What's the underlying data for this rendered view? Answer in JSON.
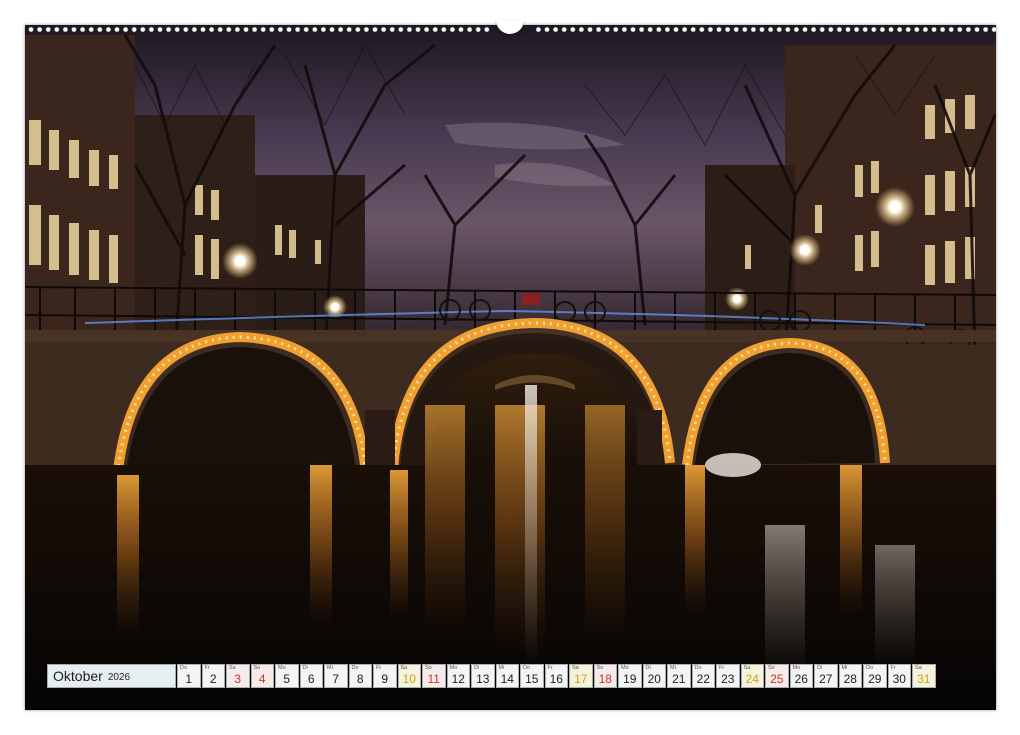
{
  "calendar": {
    "month": "Oktober",
    "year": "2026",
    "days": [
      {
        "abbr": "Do",
        "num": "1",
        "kind": "weekday"
      },
      {
        "abbr": "Fr",
        "num": "2",
        "kind": "weekday"
      },
      {
        "abbr": "Sa",
        "num": "3",
        "kind": "sun"
      },
      {
        "abbr": "So",
        "num": "4",
        "kind": "sun"
      },
      {
        "abbr": "Mo",
        "num": "5",
        "kind": "weekday"
      },
      {
        "abbr": "Di",
        "num": "6",
        "kind": "weekday"
      },
      {
        "abbr": "Mi",
        "num": "7",
        "kind": "weekday"
      },
      {
        "abbr": "Do",
        "num": "8",
        "kind": "weekday"
      },
      {
        "abbr": "Fr",
        "num": "9",
        "kind": "weekday"
      },
      {
        "abbr": "Sa",
        "num": "10",
        "kind": "sat"
      },
      {
        "abbr": "So",
        "num": "11",
        "kind": "sun"
      },
      {
        "abbr": "Mo",
        "num": "12",
        "kind": "weekday"
      },
      {
        "abbr": "Di",
        "num": "13",
        "kind": "weekday"
      },
      {
        "abbr": "Mi",
        "num": "14",
        "kind": "weekday"
      },
      {
        "abbr": "Do",
        "num": "15",
        "kind": "weekday"
      },
      {
        "abbr": "Fr",
        "num": "16",
        "kind": "weekday"
      },
      {
        "abbr": "Sa",
        "num": "17",
        "kind": "sat"
      },
      {
        "abbr": "So",
        "num": "18",
        "kind": "sun"
      },
      {
        "abbr": "Mo",
        "num": "19",
        "kind": "weekday"
      },
      {
        "abbr": "Di",
        "num": "20",
        "kind": "weekday"
      },
      {
        "abbr": "Mi",
        "num": "21",
        "kind": "weekday"
      },
      {
        "abbr": "Do",
        "num": "22",
        "kind": "weekday"
      },
      {
        "abbr": "Fr",
        "num": "23",
        "kind": "weekday"
      },
      {
        "abbr": "Sa",
        "num": "24",
        "kind": "sat"
      },
      {
        "abbr": "So",
        "num": "25",
        "kind": "sun"
      },
      {
        "abbr": "Mo",
        "num": "26",
        "kind": "weekday"
      },
      {
        "abbr": "Di",
        "num": "27",
        "kind": "weekday"
      },
      {
        "abbr": "Mi",
        "num": "28",
        "kind": "weekday"
      },
      {
        "abbr": "Do",
        "num": "29",
        "kind": "weekday"
      },
      {
        "abbr": "Fr",
        "num": "30",
        "kind": "weekday"
      },
      {
        "abbr": "Sa",
        "num": "31",
        "kind": "sat"
      }
    ]
  },
  "colors": {
    "bridge_glow": "#f0a030",
    "sky_purple": "#5a4a6a",
    "water_dark": "#0a0808",
    "month_cell_bg": "#e6eef0",
    "saturday_text": "#c8a21f",
    "sunday_text": "#c0392b"
  },
  "icons": {
    "binding": "wire-o-binding-icon",
    "hanger": "hanger-hook-icon"
  }
}
